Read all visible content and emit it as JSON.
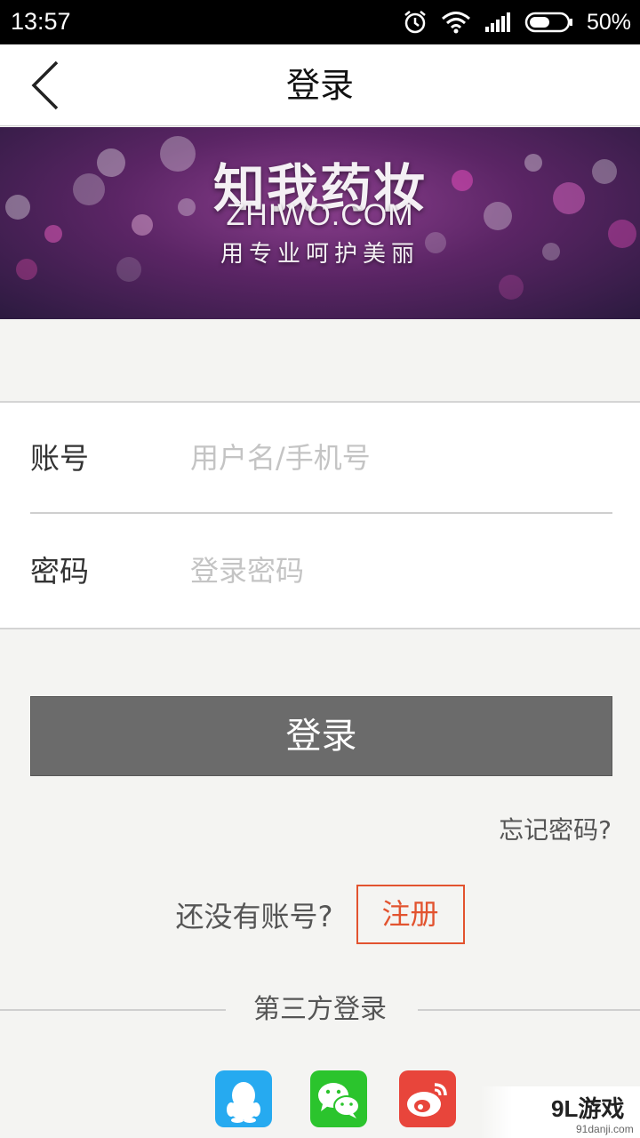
{
  "status_bar": {
    "time": "13:57",
    "battery": "50%",
    "icons": [
      "alarm-icon",
      "wifi-icon",
      "signal-icon",
      "battery-icon"
    ]
  },
  "header": {
    "title": "登录",
    "back_icon": "chevron-left-icon"
  },
  "banner": {
    "brand": "知我药妆",
    "domain": "ZHIWO.COM",
    "slogan": "用专业呵护美丽"
  },
  "form": {
    "account_label": "账号",
    "account_placeholder": "用户名/手机号",
    "account_value": "",
    "password_label": "密码",
    "password_placeholder": "登录密码",
    "password_value": ""
  },
  "actions": {
    "login_label": "登录",
    "forgot_password": "忘记密码?",
    "no_account_text": "还没有账号?",
    "register_label": "注册"
  },
  "third_party": {
    "label": "第三方登录",
    "providers": [
      "qq-icon",
      "wechat-icon",
      "weibo-icon"
    ]
  },
  "watermark": {
    "text": "9L游戏",
    "url": "91danji.com"
  },
  "colors": {
    "accent": "#e2532f",
    "login_button": "#6b6b6b",
    "qq": "#26aaf0",
    "wechat": "#2bc42d",
    "weibo": "#e8453b"
  }
}
